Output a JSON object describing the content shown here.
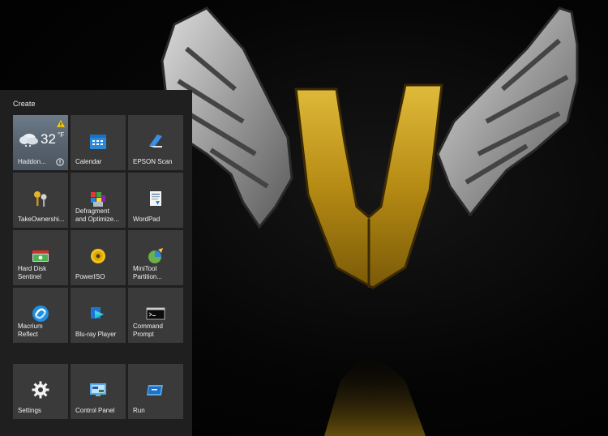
{
  "start_menu": {
    "group_title": "Create",
    "tiles": [
      {
        "label": "Haddon...",
        "icon": "weather-cloud-icon"
      },
      {
        "label": "Calendar",
        "icon": "calendar-icon"
      },
      {
        "label": "EPSON Scan",
        "icon": "epson-scan-icon"
      },
      {
        "label": "TakeOwnershi...",
        "icon": "keys-icon"
      },
      {
        "label": "Defragment\nand Optimize...",
        "icon": "defragment-icon"
      },
      {
        "label": "WordPad",
        "icon": "wordpad-icon"
      },
      {
        "label": "Hard Disk\nSentinel",
        "icon": "hard-disk-sentinel-icon"
      },
      {
        "label": "PowerISO",
        "icon": "poweriso-disc-icon"
      },
      {
        "label": "MiniTool\nPartition...",
        "icon": "minitool-icon"
      },
      {
        "label": "Macrium\nReflect",
        "icon": "macrium-reflect-icon"
      },
      {
        "label": "Blu-ray Player",
        "icon": "bluray-player-icon"
      },
      {
        "label": "Command\nPrompt",
        "icon": "command-prompt-icon"
      },
      {
        "label": "Settings",
        "icon": "gear-icon"
      },
      {
        "label": "Control Panel",
        "icon": "control-panel-icon"
      },
      {
        "label": "Run",
        "icon": "run-icon"
      }
    ],
    "weather": {
      "temperature": "32",
      "unit": "°F"
    }
  },
  "colors": {
    "panel_bg": "#1f1f1f",
    "tile_bg": "#3a3a3a",
    "weather_tile_bg": "#5f6b77",
    "logo_gold": "#c9a21f",
    "wing_silver": "#b8b8b8"
  }
}
